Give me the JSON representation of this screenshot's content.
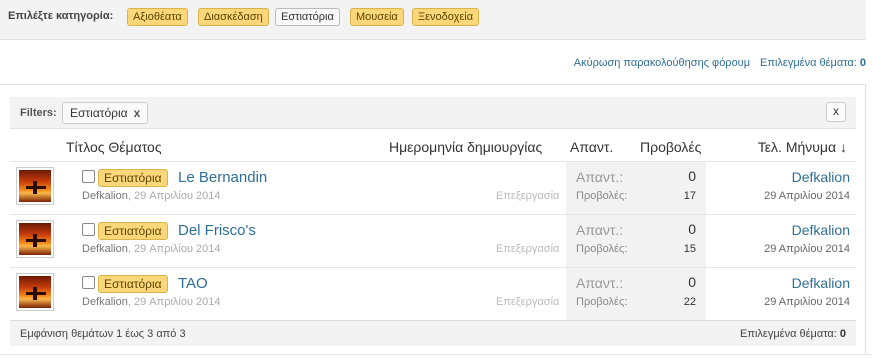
{
  "category_bar": {
    "label": "Επιλέξτε κατηγορία:",
    "chips": [
      "Αξιοθέατα",
      "Διασκέδαση",
      "Εστιατόρια",
      "Μουσεία",
      "Ξενοδοχεία"
    ],
    "active": "Εστιατόρια"
  },
  "top_links": {
    "unfollow": "Ακύρωση παρακολούθησης φόρουμ",
    "selected_label": "Επιλεγμένα θέματα:",
    "selected_count": "0"
  },
  "filters": {
    "label": "Filters:",
    "chip": "Εστιατόρια",
    "chip_close": "x",
    "close": "x"
  },
  "headers": {
    "title": "Τίτλος Θέματος",
    "date": "Ημερομηνία δημιουργίας",
    "replies": "Απαντ.",
    "views": "Προβολές",
    "last": "Τελ. Μήνυμα ↓"
  },
  "threads": [
    {
      "tag": "Εστιατόρια",
      "title": "Le Bernandin",
      "author": "Defkalion",
      "date": "29 Απριλίου 2014",
      "edit": "Επεξεργασία",
      "replies_label": "Απαντ.:",
      "replies": "0",
      "views_label": "Προβολές:",
      "views": "17",
      "last_author": "Defkalion",
      "last_date": "29 Απριλίου 2014"
    },
    {
      "tag": "Εστιατόρια",
      "title": "Del Frisco's",
      "author": "Defkalion",
      "date": "29 Απριλίου 2014",
      "edit": "Επεξεργασία",
      "replies_label": "Απαντ.:",
      "replies": "0",
      "views_label": "Προβολές:",
      "views": "15",
      "last_author": "Defkalion",
      "last_date": "29 Απριλίου 2014"
    },
    {
      "tag": "Εστιατόρια",
      "title": "TAO",
      "author": "Defkalion",
      "date": "29 Απριλίου 2014",
      "edit": "Επεξεργασία",
      "replies_label": "Απαντ.:",
      "replies": "0",
      "views_label": "Προβολές:",
      "views": "22",
      "last_author": "Defkalion",
      "last_date": "29 Απριλίου 2014"
    }
  ],
  "footer": {
    "showing": "Εμφάνιση θεμάτων 1 έως 3 από 3",
    "selected_label": "Επιλεγμένα θέματα:",
    "selected_count": "0"
  }
}
